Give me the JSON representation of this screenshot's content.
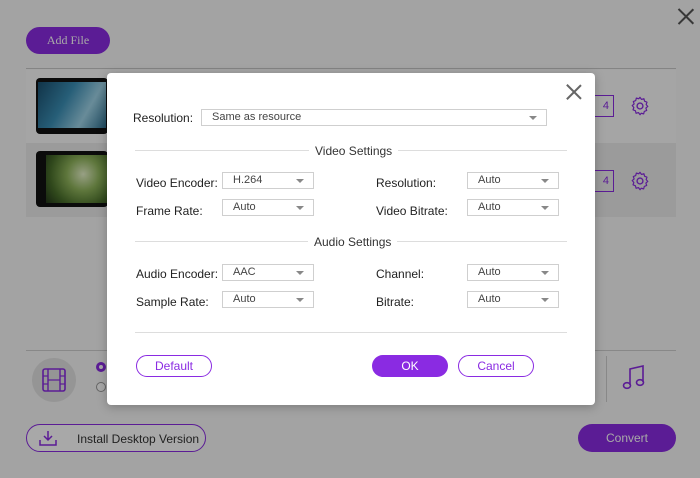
{
  "app": {
    "add_file_label": "Add File",
    "files": [
      {
        "format_suffix": "4"
      },
      {
        "format_suffix": "4"
      }
    ],
    "install_label": "Install Desktop Version",
    "convert_label": "Convert"
  },
  "dialog": {
    "resolution_label": "Resolution:",
    "resolution_value": "Same as resource",
    "video_section_title": "Video Settings",
    "video": {
      "encoder_label": "Video Encoder:",
      "encoder_value": "H.264",
      "frame_rate_label": "Frame Rate:",
      "frame_rate_value": "Auto",
      "resolution_label": "Resolution:",
      "resolution_value": "Auto",
      "bitrate_label": "Video Bitrate:",
      "bitrate_value": "Auto"
    },
    "audio_section_title": "Audio Settings",
    "audio": {
      "encoder_label": "Audio Encoder:",
      "encoder_value": "AAC",
      "sample_rate_label": "Sample Rate:",
      "sample_rate_value": "Auto",
      "channel_label": "Channel:",
      "channel_value": "Auto",
      "bitrate_label": "Bitrate:",
      "bitrate_value": "Auto"
    },
    "default_label": "Default",
    "ok_label": "OK",
    "cancel_label": "Cancel"
  },
  "colors": {
    "accent": "#8a2be2",
    "overlay": "rgba(0,0,0,0.34)"
  },
  "icons": [
    "close-icon",
    "gear-icon",
    "film-icon",
    "music-note-icon",
    "download-icon",
    "dropdown-caret-icon"
  ]
}
